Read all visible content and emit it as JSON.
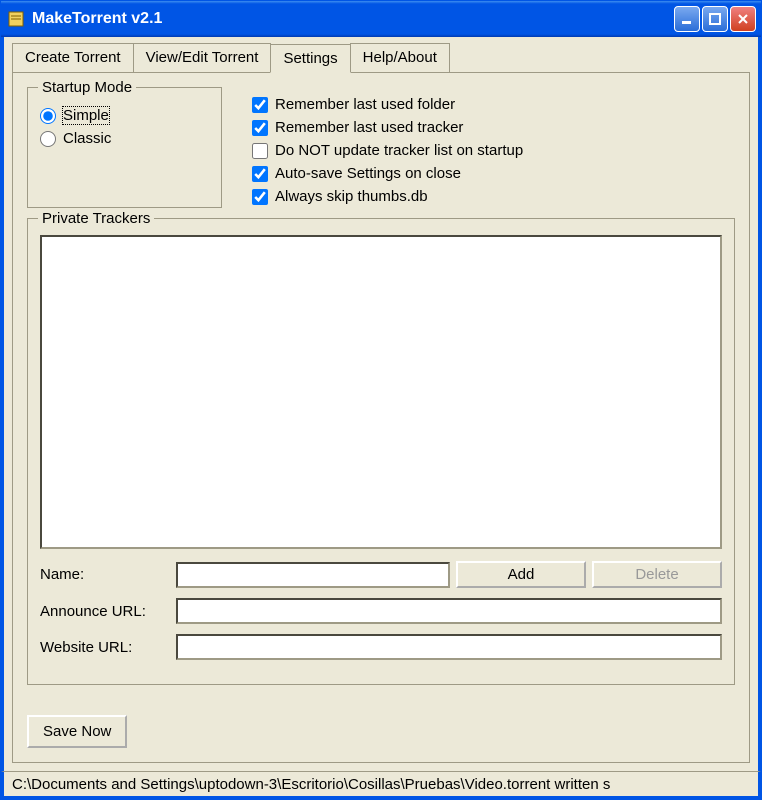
{
  "window": {
    "title": "MakeTorrent v2.1"
  },
  "tabs": [
    {
      "label": "Create Torrent",
      "active": false
    },
    {
      "label": "View/Edit Torrent",
      "active": false
    },
    {
      "label": "Settings",
      "active": true
    },
    {
      "label": "Help/About",
      "active": false
    }
  ],
  "startup": {
    "groupTitle": "Startup Mode",
    "options": [
      {
        "label": "Simple",
        "checked": true
      },
      {
        "label": "Classic",
        "checked": false
      }
    ]
  },
  "checks": [
    {
      "label": "Remember last used folder",
      "checked": true
    },
    {
      "label": "Remember last used tracker",
      "checked": true
    },
    {
      "label": "Do NOT update tracker list on startup",
      "checked": false
    },
    {
      "label": "Auto-save Settings on close",
      "checked": true
    },
    {
      "label": "Always skip thumbs.db",
      "checked": true
    }
  ],
  "trackers": {
    "groupTitle": "Private Trackers",
    "nameLabel": "Name:",
    "announceLabel": "Announce URL:",
    "websiteLabel": "Website URL:",
    "nameValue": "",
    "announceValue": "",
    "websiteValue": "",
    "addLabel": "Add",
    "deleteLabel": "Delete"
  },
  "saveLabel": "Save Now",
  "statusbar": "C:\\Documents and Settings\\uptodown-3\\Escritorio\\Cosillas\\Pruebas\\Video.torrent written s"
}
